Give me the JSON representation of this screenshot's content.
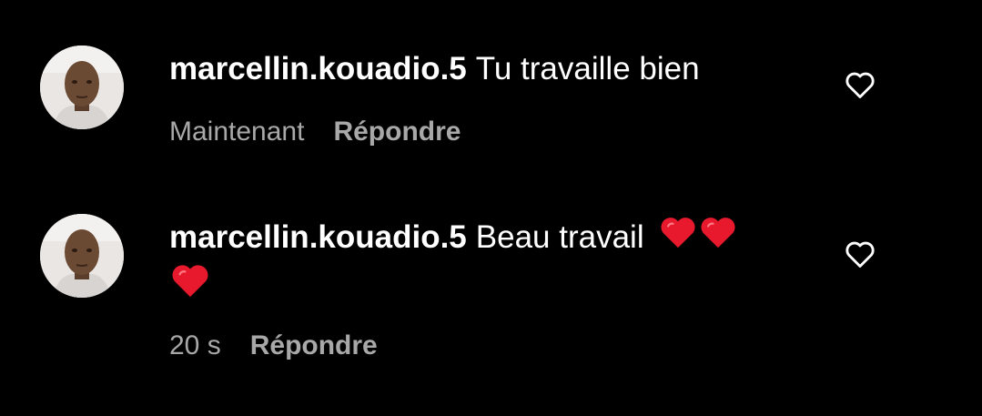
{
  "comments": [
    {
      "username": "marcellin.kouadio.5",
      "text": "Tu travaille bien",
      "time": "Maintenant",
      "reply_label": "Répondre",
      "hearts": 0,
      "avatar_icon": "user-avatar",
      "like_icon": "heart-outline-icon"
    },
    {
      "username": "marcellin.kouadio.5",
      "text": "Beau travail",
      "time": "20 s",
      "reply_label": "Répondre",
      "hearts": 3,
      "avatar_icon": "user-avatar",
      "like_icon": "heart-outline-icon"
    }
  ],
  "colors": {
    "background": "#000000",
    "text": "#ffffff",
    "meta": "#a8a8a8",
    "heart_emoji": "#e8192c"
  }
}
